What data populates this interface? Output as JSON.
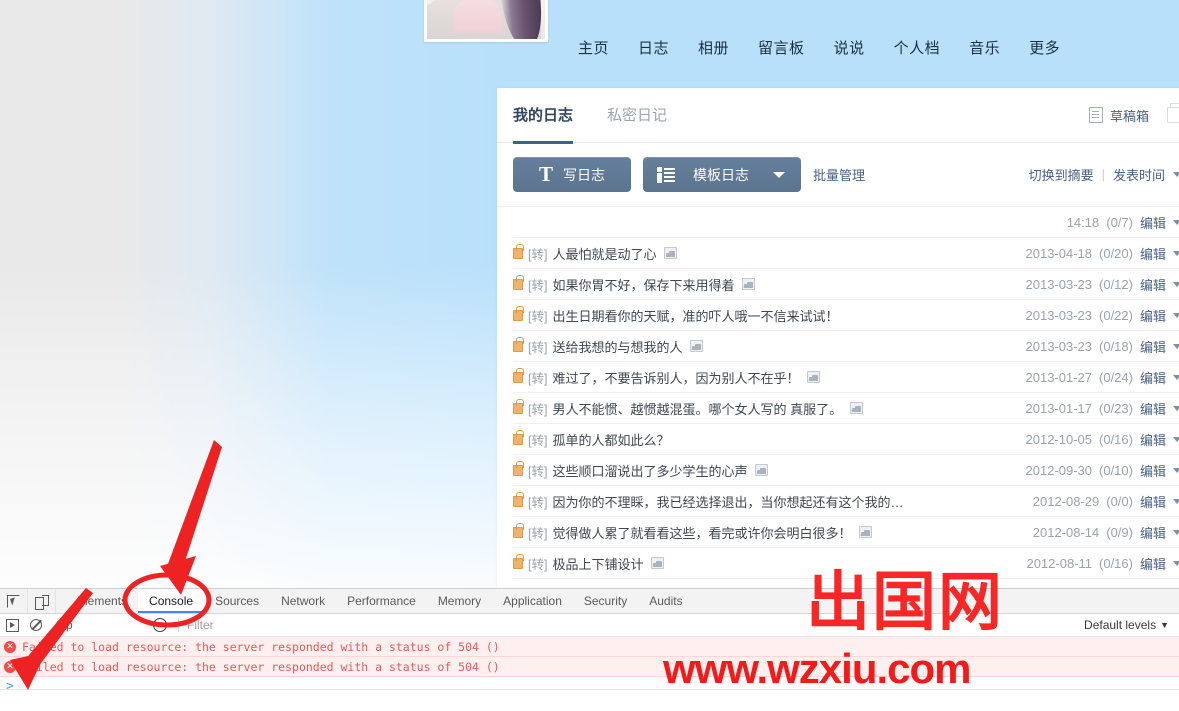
{
  "site_nav": {
    "items": [
      {
        "label": "主页"
      },
      {
        "label": "日志"
      },
      {
        "label": "相册"
      },
      {
        "label": "留言板"
      },
      {
        "label": "说说"
      },
      {
        "label": "个人档"
      },
      {
        "label": "音乐"
      },
      {
        "label": "更多"
      }
    ]
  },
  "panel": {
    "tabs": [
      {
        "label": "我的日志",
        "active": true
      },
      {
        "label": "私密日记",
        "active": false
      }
    ],
    "draft_label": "草稿箱",
    "toolbar": {
      "write_label": "写日志",
      "template_label": "模板日志",
      "batch_label": "批量管理",
      "switch_digest_label": "切换到摘要",
      "separator": "|",
      "sort_label": "发表时间"
    },
    "rows": [
      {
        "title": "",
        "tag": "",
        "locked": false,
        "has_image": false,
        "date": "14:18",
        "counts": "(0/7)",
        "edit": "编辑",
        "first": true
      },
      {
        "title": "人最怕就是动了心",
        "tag": "[转]",
        "locked": true,
        "has_image": true,
        "date": "2013-04-18",
        "counts": "(0/20)",
        "edit": "编辑"
      },
      {
        "title": "如果你胃不好，保存下来用得着",
        "tag": "[转]",
        "locked": true,
        "has_image": true,
        "date": "2013-03-23",
        "counts": "(0/12)",
        "edit": "编辑"
      },
      {
        "title": "出生日期看你的天赋，准的吓人哦一不信来试试！",
        "tag": "[转]",
        "locked": true,
        "has_image": false,
        "date": "2013-03-23",
        "counts": "(0/22)",
        "edit": "编辑"
      },
      {
        "title": "送给我想的与想我的人",
        "tag": "[转]",
        "locked": true,
        "has_image": true,
        "date": "2013-03-23",
        "counts": "(0/18)",
        "edit": "编辑"
      },
      {
        "title": "难过了，不要告诉别人，因为别人不在乎！",
        "tag": "[转]",
        "locked": true,
        "has_image": true,
        "date": "2013-01-27",
        "counts": "(0/24)",
        "edit": "编辑"
      },
      {
        "title": "男人不能惯、越惯越混蛋。哪个女人写的 真服了。",
        "tag": "[转]",
        "locked": true,
        "has_image": true,
        "date": "2013-01-17",
        "counts": "(0/23)",
        "edit": "编辑"
      },
      {
        "title": "孤单的人都如此么？",
        "tag": "[转]",
        "locked": true,
        "has_image": false,
        "date": "2012-10-05",
        "counts": "(0/16)",
        "edit": "编辑"
      },
      {
        "title": "这些顺口溜说出了多少学生的心声",
        "tag": "[转]",
        "locked": true,
        "has_image": true,
        "date": "2012-09-30",
        "counts": "(0/10)",
        "edit": "编辑"
      },
      {
        "title": "因为你的不理睬，我已经选择退出，当你想起还有这个我的…",
        "tag": "[转]",
        "locked": true,
        "has_image": false,
        "date": "2012-08-29",
        "counts": "(0/0)",
        "edit": "编辑"
      },
      {
        "title": "觉得做人累了就看看这些，看完或许你会明白很多！",
        "tag": "[转]",
        "locked": true,
        "has_image": true,
        "date": "2012-08-14",
        "counts": "(0/9)",
        "edit": "编辑"
      },
      {
        "title": "极品上下铺设计",
        "tag": "[转]",
        "locked": true,
        "has_image": true,
        "date": "2012-08-11",
        "counts": "(0/16)",
        "edit": "编辑"
      }
    ]
  },
  "devtools": {
    "tabs": [
      {
        "label": "Elements",
        "active": false
      },
      {
        "label": "Console",
        "active": true
      },
      {
        "label": "Sources",
        "active": false
      },
      {
        "label": "Network",
        "active": false
      },
      {
        "label": "Performance",
        "active": false
      },
      {
        "label": "Memory",
        "active": false
      },
      {
        "label": "Application",
        "active": false
      },
      {
        "label": "Security",
        "active": false
      },
      {
        "label": "Audits",
        "active": false
      }
    ],
    "console_toolbar": {
      "context": "top",
      "filter_placeholder": "Filter",
      "levels_label": "Default levels",
      "levels_caret": "▼"
    },
    "messages": [
      {
        "icon": "✕",
        "text": "Failed to load resource: the server responded with a status of 504 ()"
      },
      {
        "icon": "✕",
        "text": "Failed to load resource: the server responded with a status of 504 ()"
      }
    ],
    "prompt": ">"
  },
  "watermark": {
    "seal_text": "出国网",
    "url_text": "www.wzxiu.com",
    "color": "#f51a1a"
  },
  "annotations": {
    "circle_target": "Console",
    "color": "#ee2222"
  },
  "colors": {
    "accent_blue": "#4285f4",
    "panel_active": "#3b6392",
    "link": "#4a6285",
    "page_blue": "#b8e0fb"
  }
}
